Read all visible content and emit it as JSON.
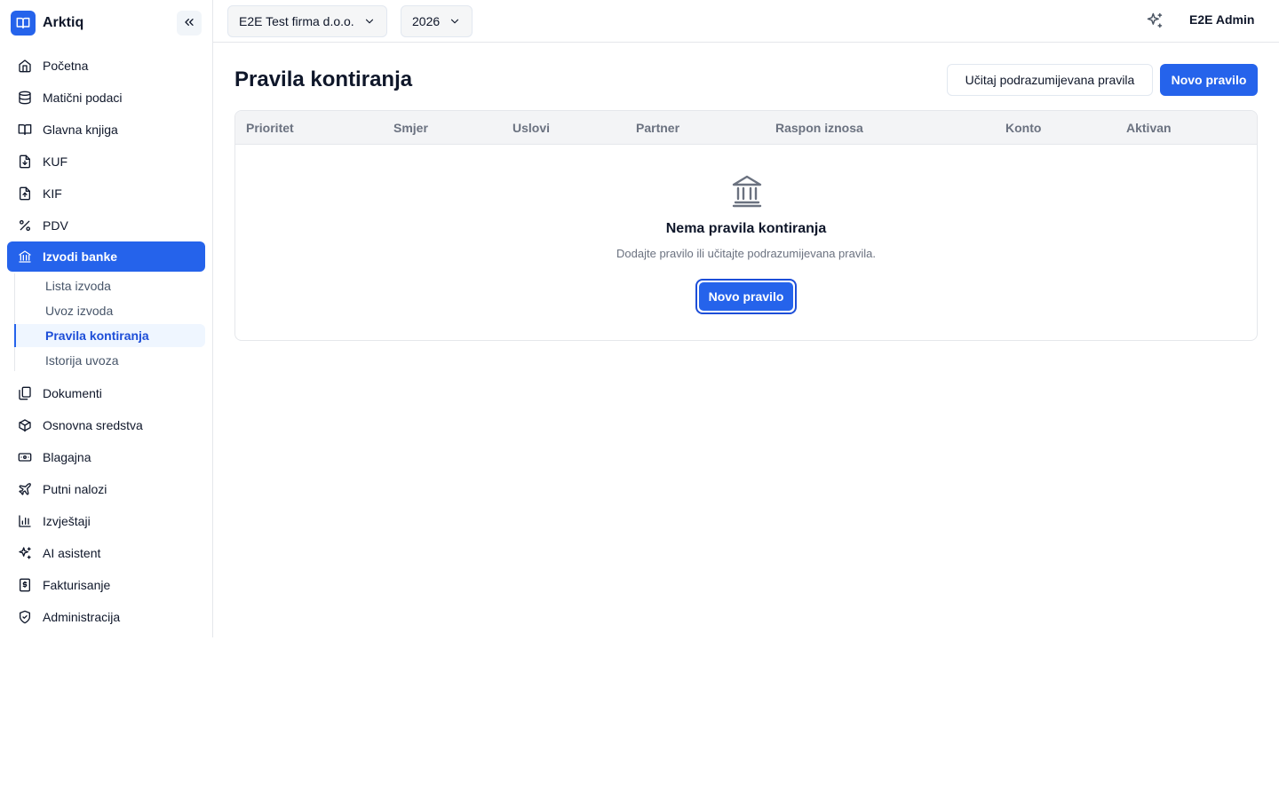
{
  "app": {
    "name": "Arktiq"
  },
  "topbar": {
    "company": "E2E Test firma d.o.o.",
    "year": "2026",
    "user": "E2E Admin"
  },
  "sidebar": {
    "items": [
      {
        "label": "Početna",
        "icon": "home-icon"
      },
      {
        "label": "Matični podaci",
        "icon": "database-icon"
      },
      {
        "label": "Glavna knjiga",
        "icon": "book-open-icon"
      },
      {
        "label": "KUF",
        "icon": "file-download-icon"
      },
      {
        "label": "KIF",
        "icon": "file-upload-icon"
      },
      {
        "label": "PDV",
        "icon": "percent-icon"
      },
      {
        "label": "Izvodi banke",
        "icon": "bank-icon",
        "active": true
      },
      {
        "label": "Dokumenti",
        "icon": "documents-icon"
      },
      {
        "label": "Osnovna sredstva",
        "icon": "box-icon"
      },
      {
        "label": "Blagajna",
        "icon": "cash-icon"
      },
      {
        "label": "Putni nalozi",
        "icon": "plane-icon"
      },
      {
        "label": "Izvještaji",
        "icon": "bar-chart-icon"
      },
      {
        "label": "AI asistent",
        "icon": "sparkles-icon"
      },
      {
        "label": "Fakturisanje",
        "icon": "invoice-dollar-icon"
      },
      {
        "label": "Administracija",
        "icon": "shield-check-icon"
      }
    ],
    "subitems": [
      {
        "label": "Lista izvoda"
      },
      {
        "label": "Uvoz izvoda"
      },
      {
        "label": "Pravila kontiranja",
        "active": true
      },
      {
        "label": "Istorija uvoza"
      }
    ]
  },
  "page": {
    "title": "Pravila kontiranja",
    "load_defaults_label": "Učitaj podrazumijevana pravila",
    "new_rule_label": "Novo pravilo"
  },
  "table": {
    "columns": [
      "Prioritet",
      "Smjer",
      "Uslovi",
      "Partner",
      "Raspon iznosa",
      "Konto",
      "Aktivan"
    ]
  },
  "empty_state": {
    "title": "Nema pravila kontiranja",
    "subtitle": "Dodajte pravilo ili učitajte podrazumijevana pravila.",
    "button_label": "Novo pravilo"
  },
  "colors": {
    "accent": "#2563eb",
    "accent_light": "#eff6ff",
    "border": "#e5e7eb",
    "muted_text": "#6b7280"
  }
}
